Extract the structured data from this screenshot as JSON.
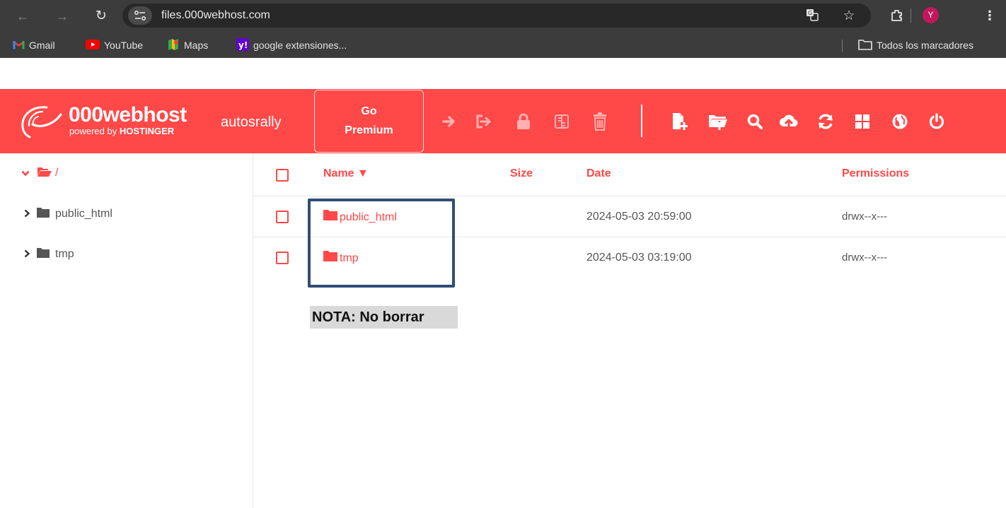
{
  "browser": {
    "url": "files.000webhost.com",
    "profile_initial": "Y",
    "bookmarks": [
      {
        "label": "Gmail"
      },
      {
        "label": "YouTube"
      },
      {
        "label": "Maps"
      },
      {
        "label": "google extensiones..."
      }
    ],
    "all_bookmarks_label": "Todos los marcadores"
  },
  "toolbar": {
    "brand_name": "000webhost",
    "brand_sub_prefix": "powered by",
    "brand_sub_strong": "HOSTINGER",
    "account": "autosrally",
    "premium_line1": "Go",
    "premium_line2": "Premium",
    "icons": [
      "arrow-right-icon",
      "sign-out-icon",
      "lock-icon",
      "archive-icon",
      "trash-icon",
      "new-file-icon",
      "new-folder-icon",
      "search-icon",
      "upload-cloud-icon",
      "refresh-icon",
      "grid-icon",
      "globe-icon",
      "power-icon"
    ],
    "accent_color": "#ff4848"
  },
  "sidebar": {
    "root_label": "/",
    "items": [
      {
        "label": "public_html"
      },
      {
        "label": "tmp"
      }
    ]
  },
  "table": {
    "columns": {
      "name": "Name ▼",
      "size": "Size",
      "date": "Date",
      "permissions": "Permissions"
    },
    "rows": [
      {
        "name": "public_html",
        "size": "",
        "date": "2024-05-03 20:59:00",
        "permissions": "drwx--x---"
      },
      {
        "name": "tmp",
        "size": "",
        "date": "2024-05-03 03:19:00",
        "permissions": "drwx--x---"
      }
    ]
  },
  "annotation": {
    "note": "NOTA: No borrar",
    "box_color": "#2f4e78"
  }
}
